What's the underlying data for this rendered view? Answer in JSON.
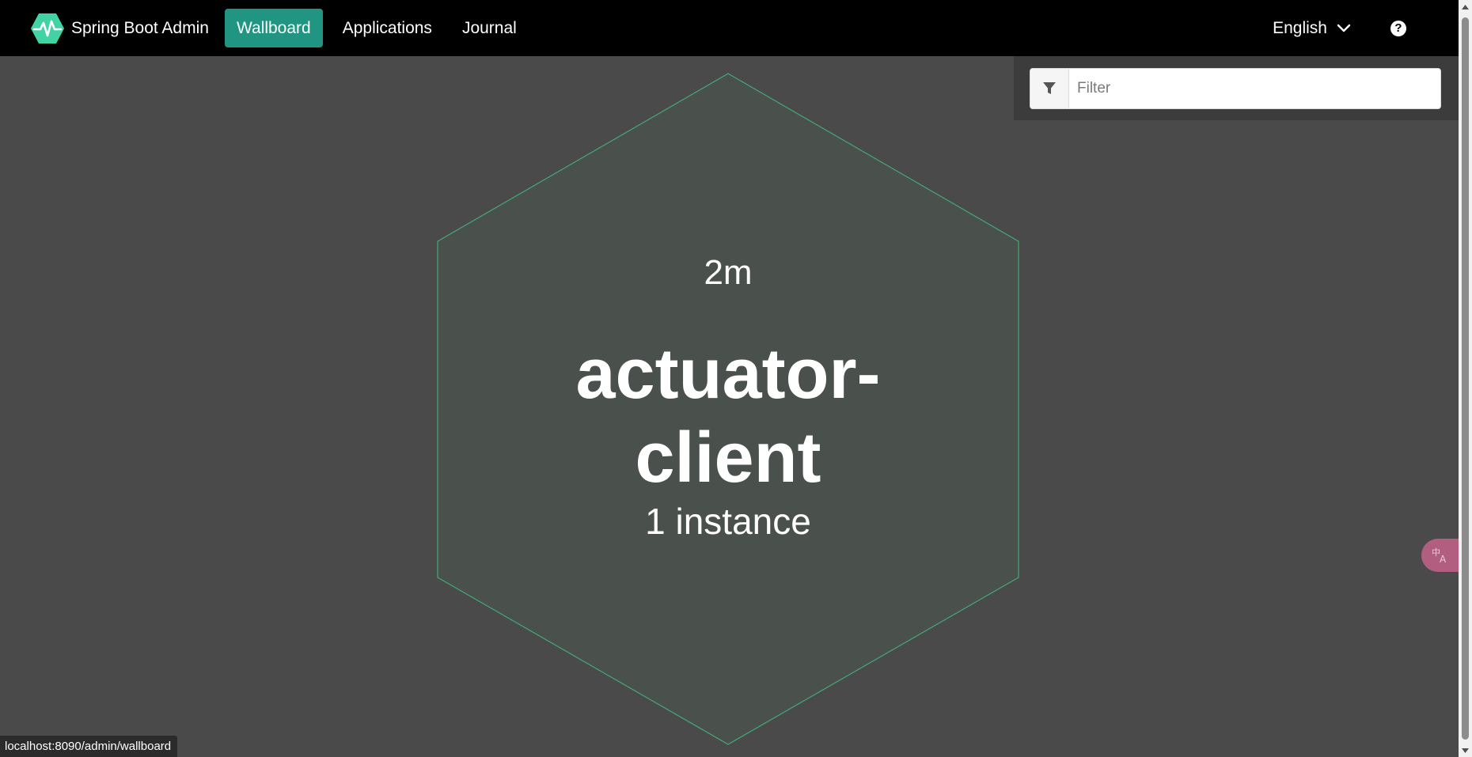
{
  "navbar": {
    "brand": "Spring Boot Admin",
    "items": [
      {
        "label": "Wallboard",
        "active": true
      },
      {
        "label": "Applications",
        "active": false
      },
      {
        "label": "Journal",
        "active": false
      }
    ],
    "language": "English",
    "help_glyph": "?"
  },
  "filter": {
    "placeholder": "Filter",
    "value": ""
  },
  "application": {
    "uptime": "2m",
    "name_line1": "actuator-",
    "name_line2": "client",
    "instances": "1 instance",
    "status_color": "#42b983"
  },
  "translate_widget": {
    "icon": "translate-icon"
  },
  "statusbar": {
    "url": "localhost:8090/admin/wallboard"
  },
  "colors": {
    "navbar_bg": "#000000",
    "active_tab": "#1f9582",
    "page_bg": "#4a4a4a",
    "hex_fill": "#4a514c",
    "hex_stroke": "#42b983",
    "brand_logo": "#42d3a5"
  }
}
